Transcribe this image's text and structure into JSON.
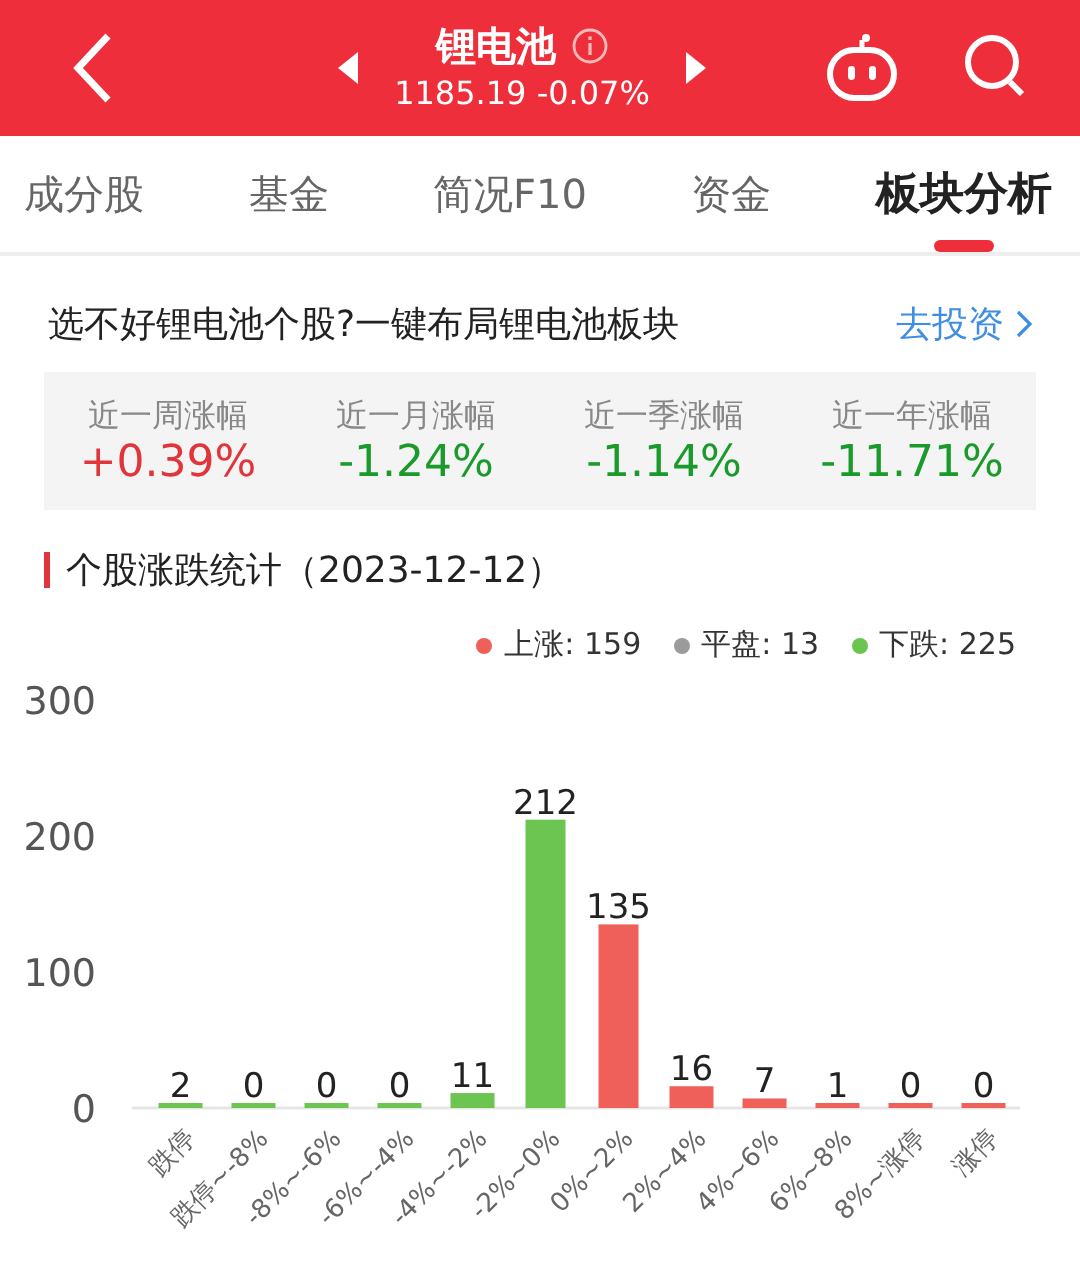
{
  "header": {
    "title": "锂电池",
    "quote": "1185.19 -0.07%"
  },
  "tabs": [
    {
      "label": "成分股",
      "selected": false
    },
    {
      "label": "基金",
      "selected": false
    },
    {
      "label": "简况F10",
      "selected": false
    },
    {
      "label": "资金",
      "selected": false
    },
    {
      "label": "板块分析",
      "selected": true
    }
  ],
  "promo": {
    "text": "选不好锂电池个股?一键布局锂电池板块",
    "link": "去投资"
  },
  "returns": [
    {
      "label": "近一周涨幅",
      "value": "+0.39%",
      "color": "#e0353a"
    },
    {
      "label": "近一月涨幅",
      "value": "-1.24%",
      "color": "#1a9a2a"
    },
    {
      "label": "近一季涨幅",
      "value": "-1.14%",
      "color": "#1a9a2a"
    },
    {
      "label": "近一年涨幅",
      "value": "-11.71%",
      "color": "#1a9a2a"
    }
  ],
  "section_title": "个股涨跌统计（2023-12-12）",
  "legend": [
    {
      "label": "上涨: 159",
      "color": "#f0605a"
    },
    {
      "label": "平盘: 13",
      "color": "#9b9b9b"
    },
    {
      "label": "下跌: 225",
      "color": "#6cc551"
    }
  ],
  "chart_data": {
    "type": "bar",
    "data_labels": true,
    "ylim": [
      0,
      300
    ],
    "yticks": [
      0,
      100,
      200,
      300
    ],
    "categories": [
      "跌停",
      "跌停~-8%",
      "-8%~-6%",
      "-6%~-4%",
      "-4%~-2%",
      "-2%~0%",
      "0%~2%",
      "2%~4%",
      "4%~6%",
      "6%~8%",
      "8%~涨停",
      "涨停"
    ],
    "series": [
      {
        "color": "#6cc551",
        "values": [
          2,
          0,
          0,
          0,
          11,
          212,
          null,
          null,
          null,
          null,
          null,
          null
        ]
      },
      {
        "color": "#f0605a",
        "values": [
          null,
          null,
          null,
          null,
          null,
          null,
          135,
          16,
          7,
          1,
          0,
          0
        ]
      }
    ]
  }
}
